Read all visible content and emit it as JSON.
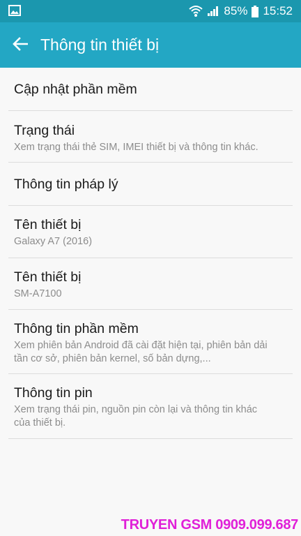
{
  "status_bar": {
    "battery_percent": "85%",
    "time": "15:52",
    "left_icon": "image-icon",
    "icons": [
      "wifi-icon",
      "signal-icon",
      "battery-icon"
    ]
  },
  "app_bar": {
    "title": "Thông tin thiết bị",
    "back_icon": "arrow-left-icon"
  },
  "items": [
    {
      "title": "Cập nhật phần mềm",
      "sub": ""
    },
    {
      "title": "Trạng thái",
      "sub": "Xem trạng thái thẻ SIM, IMEI thiết bị và thông tin khác."
    },
    {
      "title": "Thông tin pháp lý",
      "sub": ""
    },
    {
      "title": "Tên thiết bị",
      "sub": "Galaxy A7 (2016)"
    },
    {
      "title": "Tên thiết bị",
      "sub": "SM-A7100"
    },
    {
      "title": "Thông tin phần mềm",
      "sub_line1": "Xem phiên bản Android đã cài đặt hiện tại, phiên bản dải",
      "sub_line2": "tần cơ sở, phiên bản kernel, số bản dựng,..."
    },
    {
      "title": "Thông tin pin",
      "sub_line1": "Xem trạng thái pin, nguồn pin còn lại và thông tin khác",
      "sub_line2": "của thiết bị."
    }
  ],
  "watermark": "TRUYEN GSM 0909.099.687",
  "colors": {
    "status_bar": "#1b97ae",
    "app_bar": "#23a7c4",
    "background": "#f8f8f8",
    "watermark": "#e020d8"
  }
}
